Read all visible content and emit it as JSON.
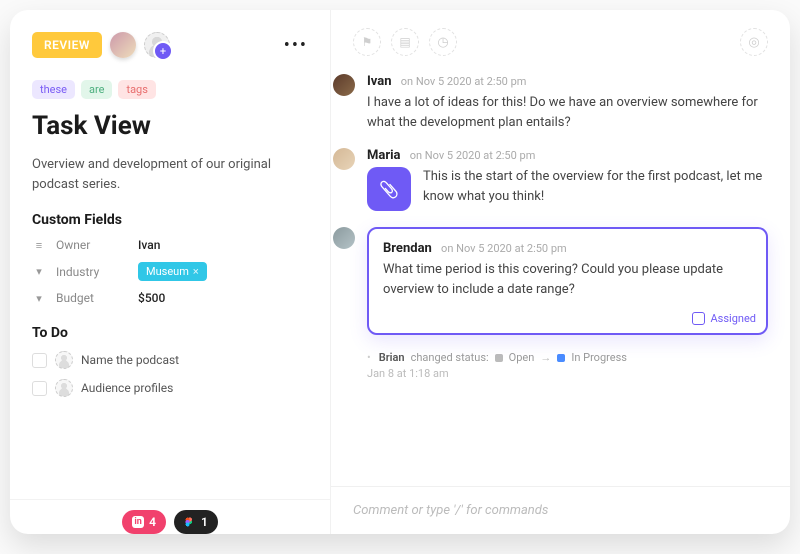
{
  "header": {
    "review_label": "REVIEW"
  },
  "tags": {
    "t1": "these",
    "t2": "are",
    "t3": "tags"
  },
  "title": "Task View",
  "description": "Overview and development of our original podcast series.",
  "custom_fields_title": "Custom Fields",
  "fields": {
    "owner_label": "Owner",
    "owner_value": "Ivan",
    "industry_label": "Industry",
    "industry_value": "Museum",
    "budget_label": "Budget",
    "budget_value": "$500"
  },
  "todo_title": "To Do",
  "todos": {
    "t1": "Name the podcast",
    "t2": "Audience profiles"
  },
  "bottom": {
    "pink_count": "4",
    "dark_count": "1"
  },
  "comments": {
    "c1": {
      "author": "Ivan",
      "time": "on Nov 5 2020 at 2:50 pm",
      "text": "I have a lot of ideas for this! Do we have an overview somewhere for what the development plan entails?"
    },
    "c2": {
      "author": "Maria",
      "time": "on Nov 5 2020 at 2:50 pm",
      "text": "This is the start of the overview for the first podcast, let me know what you think!"
    },
    "c3": {
      "author": "Brendan",
      "time": "on Nov 5 2020 at 2:50 pm",
      "text": "What time period is this covering? Could you please update overview to include a date range?",
      "assigned_label": "Assigned"
    }
  },
  "activity": {
    "actor": "Brian",
    "verb": "changed status:",
    "from": "Open",
    "to": "In Progress",
    "date": "Jan 8 at 1:18 am"
  },
  "compose_placeholder": "Comment or type '/' for commands"
}
